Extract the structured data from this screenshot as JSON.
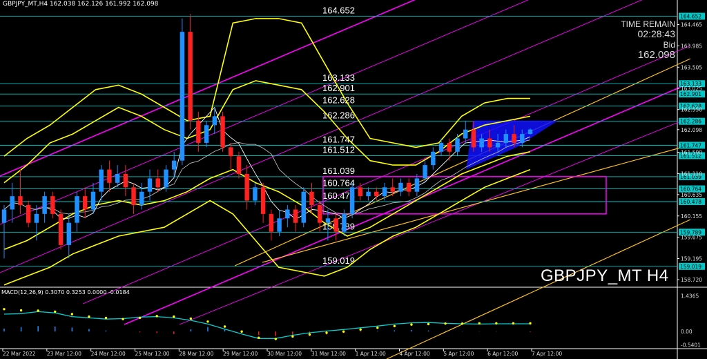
{
  "header": {
    "symbol_tf": "GBPJPY_MT,H4",
    "ohlc": "162.038 162.126 161.992 162.098"
  },
  "timer": {
    "label": "TIME REMAIN",
    "value": "02:28:43",
    "bid_label": "Bid",
    "bid_value": "162.098"
  },
  "watermark": "GBPJPY_MT H4",
  "macd_header": "MACD(12,26,9) 0.3070 0.3253 0.0000 -0.0184",
  "colors": {
    "bull": "#1e90ff",
    "bear": "#ff2020",
    "level": "#00c8c8",
    "band": "#ffff00",
    "fib": "#ff00ff",
    "trend": "#ffc020",
    "box": "#ff00ff",
    "triangle": "#1010ff"
  },
  "chart_data": {
    "type": "candlestick",
    "symbol": "GBPJPY_MT",
    "timeframe": "H4",
    "ylim": [
      158.55,
      164.8
    ],
    "price_ticks": [
      "164.465",
      "163.985",
      "163.505",
      "163.025",
      "162.550",
      "162.098",
      "161.590",
      "161.110",
      "160.635",
      "160.155",
      "159.675",
      "159.195",
      "158.720"
    ],
    "level_labels": [
      "164.652",
      "163.133",
      "162.901",
      "162.628",
      "162.286",
      "161.747",
      "161.512",
      "161.039",
      "160.764",
      "160.478",
      "159.789",
      "159.019"
    ],
    "date_labels": [
      "22 Mar 2022",
      "23 Mar 12:00",
      "24 Mar 12:00",
      "25 Mar 12:00",
      "28 Mar 12:00",
      "29 Mar 12:00",
      "30 Mar 12:00",
      "31 Mar 12:00",
      "1 Apr 12:00",
      "4 Apr 12:00",
      "5 Apr 12:00",
      "6 Apr 12:00",
      "7 Apr 12:00"
    ],
    "candles": [
      [
        160.0,
        160.4,
        159.2,
        160.3
      ],
      [
        160.3,
        160.9,
        160.0,
        160.6
      ],
      [
        160.6,
        161.2,
        160.2,
        160.4
      ],
      [
        160.4,
        160.5,
        159.9,
        160.0
      ],
      [
        160.0,
        160.4,
        159.6,
        160.2
      ],
      [
        160.2,
        160.7,
        160.0,
        160.6
      ],
      [
        160.6,
        160.7,
        160.1,
        160.2
      ],
      [
        160.2,
        160.3,
        159.4,
        159.5
      ],
      [
        159.5,
        160.2,
        159.2,
        160.0
      ],
      [
        160.0,
        160.7,
        159.8,
        160.6
      ],
      [
        160.6,
        160.8,
        160.1,
        160.3
      ],
      [
        160.3,
        160.9,
        160.2,
        160.7
      ],
      [
        160.7,
        161.3,
        160.5,
        161.2
      ],
      [
        161.2,
        161.4,
        160.7,
        160.9
      ],
      [
        160.9,
        161.3,
        160.8,
        161.1
      ],
      [
        161.1,
        161.3,
        160.6,
        160.8
      ],
      [
        160.8,
        160.9,
        160.2,
        160.4
      ],
      [
        160.4,
        160.9,
        160.3,
        160.7
      ],
      [
        160.7,
        161.2,
        160.5,
        161.0
      ],
      [
        161.0,
        161.2,
        160.7,
        160.8
      ],
      [
        160.8,
        161.3,
        160.7,
        161.2
      ],
      [
        161.2,
        161.6,
        161.0,
        161.4
      ],
      [
        161.4,
        164.6,
        161.3,
        164.3
      ],
      [
        164.3,
        164.7,
        162.1,
        162.3
      ],
      [
        162.3,
        162.5,
        161.6,
        161.8
      ],
      [
        161.8,
        162.3,
        161.7,
        162.2
      ],
      [
        162.2,
        162.6,
        162.0,
        162.4
      ],
      [
        162.4,
        162.5,
        161.6,
        161.7
      ],
      [
        161.7,
        161.8,
        161.2,
        161.5
      ],
      [
        161.5,
        161.6,
        161.0,
        161.1
      ],
      [
        161.1,
        161.3,
        160.3,
        160.5
      ],
      [
        160.5,
        160.9,
        160.4,
        160.8
      ],
      [
        160.8,
        160.9,
        160.0,
        160.2
      ],
      [
        160.2,
        160.3,
        159.6,
        159.8
      ],
      [
        159.8,
        160.3,
        159.7,
        160.1
      ],
      [
        160.1,
        160.4,
        159.9,
        160.3
      ],
      [
        160.3,
        160.4,
        159.8,
        160.0
      ],
      [
        160.0,
        160.8,
        159.9,
        160.7
      ],
      [
        160.7,
        160.9,
        160.2,
        160.4
      ],
      [
        160.4,
        160.5,
        159.8,
        160.0
      ],
      [
        160.0,
        160.3,
        159.6,
        160.1
      ],
      [
        160.1,
        160.2,
        159.6,
        159.8
      ],
      [
        159.8,
        160.3,
        159.7,
        160.2
      ],
      [
        160.2,
        160.9,
        160.1,
        160.8
      ],
      [
        160.8,
        160.9,
        160.5,
        160.6
      ],
      [
        160.6,
        160.8,
        160.5,
        160.7
      ],
      [
        160.7,
        160.8,
        160.5,
        160.6
      ],
      [
        160.6,
        160.9,
        160.5,
        160.8
      ],
      [
        160.8,
        161.0,
        160.6,
        160.7
      ],
      [
        160.7,
        161.0,
        160.6,
        160.9
      ],
      [
        160.9,
        161.0,
        160.6,
        160.7
      ],
      [
        160.7,
        161.1,
        160.6,
        161.0
      ],
      [
        161.0,
        161.4,
        160.9,
        161.3
      ],
      [
        161.3,
        161.7,
        161.2,
        161.6
      ],
      [
        161.6,
        161.9,
        161.5,
        161.8
      ],
      [
        161.8,
        161.9,
        161.4,
        161.6
      ],
      [
        161.6,
        162.0,
        161.5,
        161.9
      ],
      [
        161.9,
        162.3,
        161.8,
        162.1
      ],
      [
        162.1,
        162.3,
        161.6,
        161.7
      ],
      [
        161.7,
        162.0,
        161.6,
        161.9
      ],
      [
        161.9,
        162.1,
        161.6,
        161.7
      ],
      [
        161.7,
        162.0,
        161.6,
        161.8
      ],
      [
        161.8,
        162.1,
        161.7,
        162.0
      ],
      [
        162.0,
        162.2,
        161.7,
        161.8
      ],
      [
        161.8,
        162.1,
        161.7,
        162.0
      ],
      [
        162.0,
        162.13,
        161.99,
        162.1
      ]
    ],
    "bands": {
      "upper_outer": [
        161.5,
        161.9,
        162.2,
        162.6,
        163.0,
        163.1,
        162.9,
        162.6,
        162.3,
        162.4,
        164.5,
        164.6,
        164.6,
        164.5,
        163.6,
        162.7,
        161.9,
        161.8,
        161.7,
        161.8,
        162.4,
        162.7,
        162.8,
        162.8
      ],
      "upper_inner": [
        160.9,
        161.3,
        161.8,
        162.0,
        162.3,
        162.6,
        162.4,
        162.1,
        161.9,
        162.1,
        163.0,
        163.2,
        163.1,
        163.0,
        162.5,
        161.9,
        161.4,
        161.3,
        161.3,
        161.6,
        162.0,
        162.2,
        162.3,
        162.4
      ],
      "lower_inner": [
        159.4,
        159.6,
        159.9,
        160.2,
        160.4,
        160.5,
        160.4,
        160.5,
        160.7,
        161.0,
        161.2,
        160.9,
        160.7,
        160.4,
        160.0,
        159.7,
        159.9,
        160.2,
        160.5,
        160.8,
        161.1,
        161.3,
        161.5,
        161.6
      ],
      "lower_outer": [
        158.6,
        158.8,
        159.0,
        159.3,
        159.5,
        159.7,
        159.8,
        159.9,
        160.2,
        160.5,
        160.2,
        159.6,
        159.0,
        158.9,
        158.8,
        159.0,
        159.4,
        159.7,
        159.9,
        160.2,
        160.5,
        160.8,
        161.0,
        161.2
      ]
    },
    "macd": {
      "histogram": [
        0.12,
        0.18,
        0.22,
        0.2,
        0.16,
        0.1,
        0.04,
        0.0,
        -0.03,
        -0.06,
        -0.1,
        0.09,
        0.18,
        0.1,
        -0.05,
        -0.14,
        -0.18,
        -0.2,
        -0.18,
        -0.12,
        -0.06,
        -0.02,
        0.02,
        0.05,
        0.06,
        0.04,
        0.02,
        0.01,
        0.01,
        0.01,
        0.0,
        -0.02
      ],
      "signal_line": [
        0.9,
        0.85,
        0.84,
        0.8,
        0.7,
        0.6,
        0.55,
        0.5,
        0.55,
        0.62,
        0.6,
        0.52,
        0.4,
        0.2,
        0.0,
        -0.25,
        -0.3,
        -0.2,
        -0.12,
        -0.05,
        0.0,
        0.08,
        0.15,
        0.22,
        0.28,
        0.3,
        0.32,
        0.32,
        0.33,
        0.33,
        0.33,
        0.33
      ],
      "macd_line": [
        0.7,
        0.72,
        0.8,
        0.75,
        0.6,
        0.55,
        0.5,
        0.52,
        0.58,
        0.6,
        0.55,
        0.45,
        0.3,
        0.1,
        -0.1,
        -0.28,
        -0.28,
        -0.15,
        -0.05,
        0.02,
        0.08,
        0.15,
        0.22,
        0.3,
        0.35,
        0.36,
        0.33,
        0.31,
        0.3,
        0.31,
        0.31,
        0.31
      ],
      "ticks": [
        "1.4365",
        "0.00",
        "-0.5401"
      ],
      "ylim": [
        -0.55,
        1.45
      ]
    }
  }
}
